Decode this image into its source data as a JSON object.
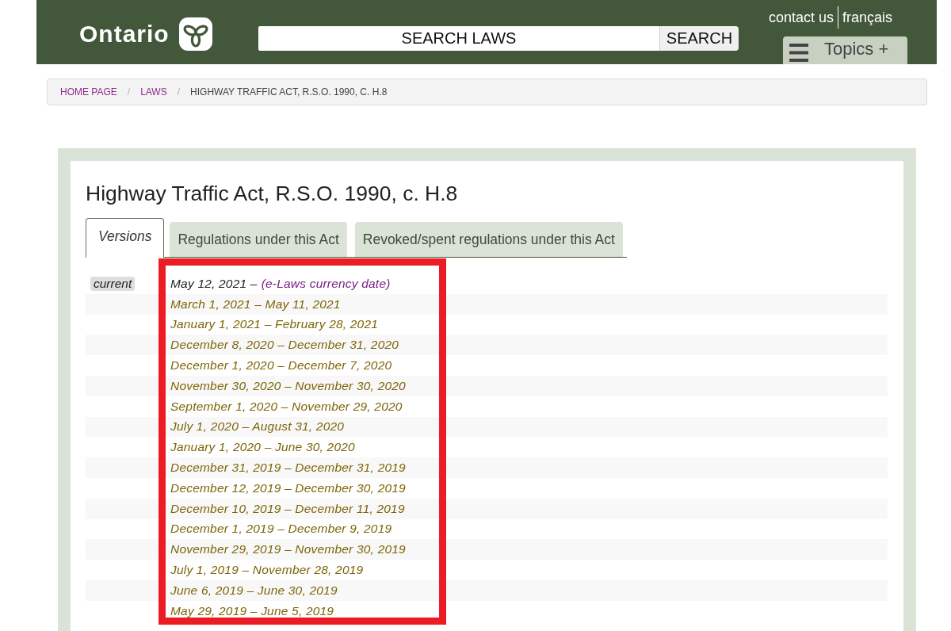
{
  "header": {
    "logo": "Ontario",
    "search": {
      "placeholder": "SEARCH LAWS",
      "button": "SEARCH"
    },
    "links": [
      "contact us",
      "français"
    ],
    "topics_button": "Topics +"
  },
  "breadcrumb": [
    {
      "kind": "link",
      "label": "HOME PAGE"
    },
    {
      "kind": "separator",
      "label": "/"
    },
    {
      "kind": "link",
      "label": "LAWS"
    },
    {
      "kind": "separator",
      "label": "/"
    },
    {
      "kind": "current",
      "label": "HIGHWAY TRAFFIC ACT, R.S.O. 1990, C. H.8"
    }
  ],
  "act": {
    "title": "Highway Traffic Act, R.S.O. 1990, c. H.8",
    "tabs": [
      {
        "label": "Versions",
        "selected": true
      },
      {
        "label": "Regulations under this Act",
        "selected": false
      },
      {
        "label": "Revoked/spent regulations under this Act",
        "selected": false
      }
    ],
    "versions_highlighted": true,
    "versions": [
      {
        "kind": "current",
        "badge": "current",
        "date": "May 12, 2021 –",
        "note": "(e-Laws currency date)"
      },
      {
        "kind": "link",
        "date": "March 1, 2021 – May 11, 2021"
      },
      {
        "kind": "link",
        "date": "January 1, 2021 – February 28, 2021"
      },
      {
        "kind": "link",
        "date": "December 8, 2020 – December 31, 2020"
      },
      {
        "kind": "link",
        "date": "December 1, 2020 – December 7, 2020"
      },
      {
        "kind": "link",
        "date": "November 30, 2020 – November 30, 2020"
      },
      {
        "kind": "link",
        "date": "September 1, 2020 – November 29, 2020"
      },
      {
        "kind": "link",
        "date": "July 1, 2020 – August 31, 2020"
      },
      {
        "kind": "link",
        "date": "January 1, 2020 – June 30, 2020"
      },
      {
        "kind": "link",
        "date": "December 31, 2019 – December 31, 2019"
      },
      {
        "kind": "link",
        "date": "December 12, 2019 – December 30, 2019"
      },
      {
        "kind": "link",
        "date": "December 10, 2019 – December 11, 2019"
      },
      {
        "kind": "link",
        "date": "December 1, 2019 – December 9, 2019"
      },
      {
        "kind": "link",
        "date": "November 29, 2019 – November 30, 2019"
      },
      {
        "kind": "link",
        "date": "July 1, 2019 – November 28, 2019"
      },
      {
        "kind": "link",
        "date": "June 6, 2019 – June 30, 2019"
      },
      {
        "kind": "link",
        "date": "May 29, 2019 – June 5, 2019"
      }
    ]
  }
}
